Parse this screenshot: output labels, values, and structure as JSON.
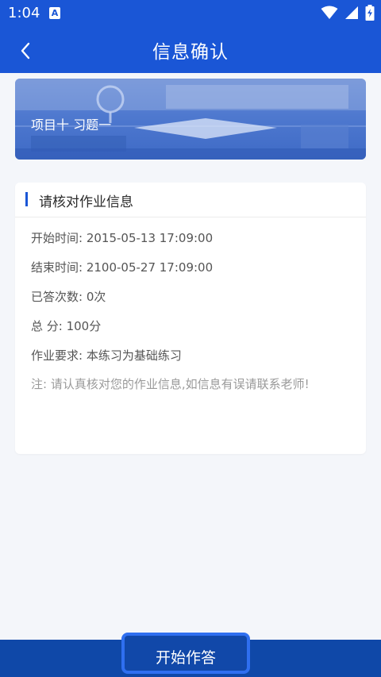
{
  "status_bar": {
    "time": "1:04",
    "notification_icon": "A"
  },
  "header": {
    "title": "信息确认",
    "back_icon": "chevron-left-icon"
  },
  "banner": {
    "title": "项目十 习题一"
  },
  "info_card": {
    "title": "请核对作业信息",
    "rows": [
      "开始时间: 2015-05-13 17:09:00",
      "结束时间: 2100-05-27 17:09:00",
      "已答次数: 0次",
      "总 分: 100分",
      "作业要求: 本练习为基础练习"
    ],
    "note": "注: 请认真核对您的作业信息,如信息有误请联系老师!"
  },
  "footer": {
    "start_label": "开始作答"
  },
  "colors": {
    "primary": "#1a56d6",
    "footer": "#0f48a8",
    "button_border": "#2f6ff0"
  }
}
